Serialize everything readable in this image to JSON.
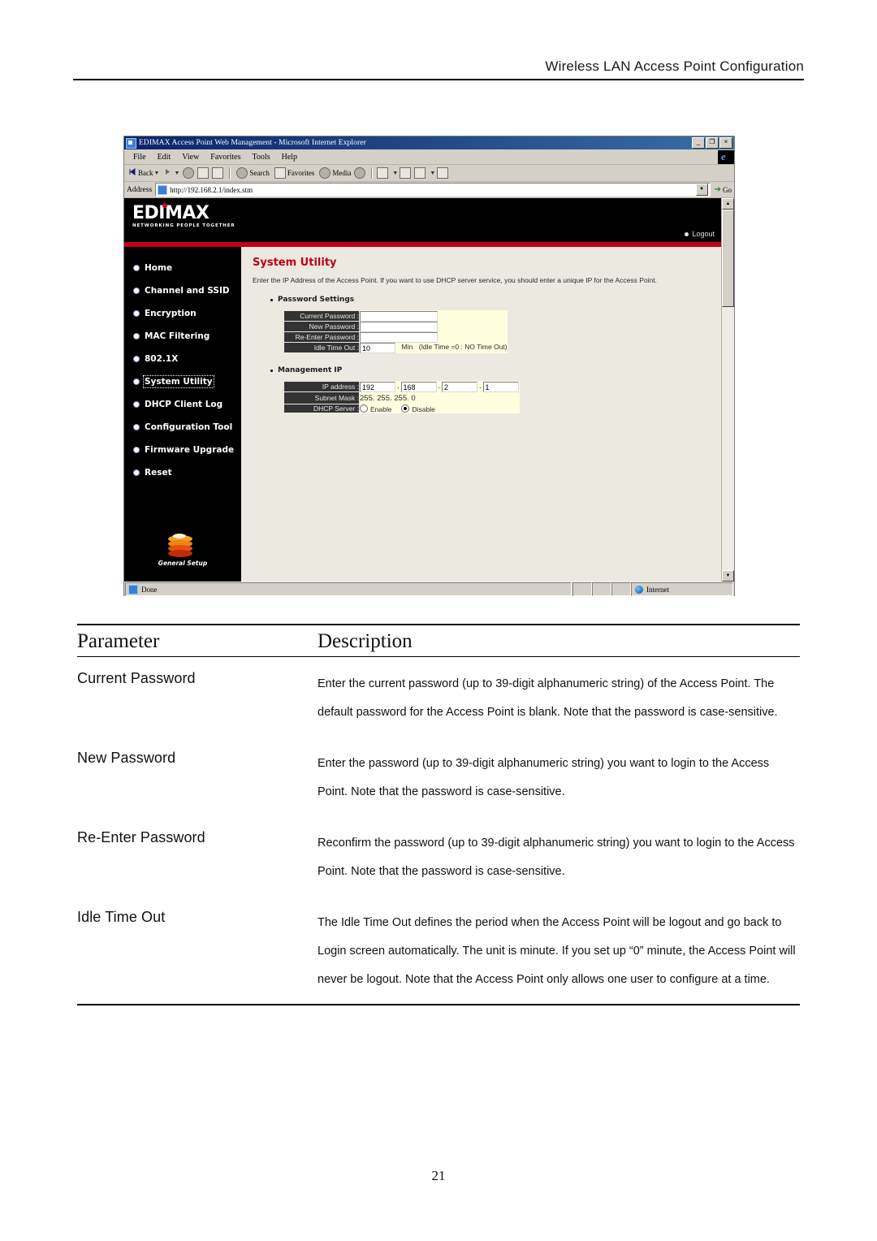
{
  "document": {
    "header": "Wireless LAN Access Point Configuration",
    "page_number": "21"
  },
  "browser": {
    "title": "EDIMAX Access Point Web Management - Microsoft Internet Explorer",
    "window_buttons": {
      "minimize": "_",
      "restore": "❐",
      "close": "×"
    },
    "menus": [
      "File",
      "Edit",
      "View",
      "Favorites",
      "Tools",
      "Help"
    ],
    "toolbar": {
      "back": "Back",
      "forward": "",
      "search": "Search",
      "favorites": "Favorites",
      "media": "Media"
    },
    "address": {
      "label": "Address",
      "url": "http://192.168.2.1/index.stm",
      "go": "Go"
    },
    "status": {
      "left": "Done",
      "zone": "Internet"
    }
  },
  "webpage": {
    "logo": {
      "name": "EDIMAX",
      "tagline": "NETWORKING PEOPLE TOGETHER"
    },
    "logout": "Logout",
    "nav": [
      {
        "label": "Home",
        "active": false
      },
      {
        "label": "Channel and SSID",
        "active": false
      },
      {
        "label": "Encryption",
        "active": false
      },
      {
        "label": "MAC Filtering",
        "active": false
      },
      {
        "label": "802.1X",
        "active": false
      },
      {
        "label": "System Utility",
        "active": true
      },
      {
        "label": "DHCP Client Log",
        "active": false
      },
      {
        "label": "Configuration Tool",
        "active": false
      },
      {
        "label": "Firmware Upgrade",
        "active": false
      },
      {
        "label": "Reset",
        "active": false
      }
    ],
    "sidebar_footer": "General Setup",
    "content": {
      "title": "System Utility",
      "description": "Enter the IP Address of the Access Point. If you want to use DHCP server service, you should enter a unique IP for the Access Point.",
      "password_section": {
        "heading": "Password Settings",
        "fields": [
          {
            "label": "Current Password :",
            "value": ""
          },
          {
            "label": "New Password :",
            "value": ""
          },
          {
            "label": "Re-Enter Password :",
            "value": ""
          }
        ],
        "idle": {
          "label": "Idle Time Out :",
          "value": "10",
          "unit": "Min",
          "note": "(Idle Time =0 : NO Time Out)"
        }
      },
      "management_section": {
        "heading": "Management IP",
        "ip_label": "IP address :",
        "ip_octets": [
          "192",
          "168",
          "2",
          "1"
        ],
        "subnet_label": "Subnet Mask :",
        "subnet_value": "255. 255. 255. 0",
        "dhcp_label": "DHCP Server :",
        "dhcp_options": [
          {
            "label": "Enable",
            "selected": false
          },
          {
            "label": "Disable",
            "selected": true
          }
        ]
      }
    },
    "colors": {
      "brand_red": "#c00014",
      "banner_black": "#000000",
      "field_yellow": "#ffffe0",
      "label_gray": "#333333",
      "page_bg": "#ece9e0"
    }
  },
  "parameter_table": {
    "headers": {
      "parameter": "Parameter",
      "description": "Description"
    },
    "rows": [
      {
        "parameter": "Current Password",
        "description": "Enter the current password (up to 39-digit alphanumeric string) of the Access Point. The default password for the Access Point is blank. Note that the password is case-sensitive."
      },
      {
        "parameter": "New Password",
        "description": "Enter the password (up to 39-digit alphanumeric string) you want to login to the Access Point. Note that the password is case-sensitive."
      },
      {
        "parameter": "Re-Enter Password",
        "description": "Reconfirm the password (up to 39-digit alphanumeric string) you want to login to the Access Point. Note that the password is case-sensitive."
      },
      {
        "parameter": "Idle Time Out",
        "description": "The Idle Time Out defines the period when the Access Point will be logout and go back to Login screen automatically. The unit is minute. If you set up “0” minute, the Access Point will never be logout. Note that the Access Point only allows one user to configure at a time."
      }
    ]
  }
}
